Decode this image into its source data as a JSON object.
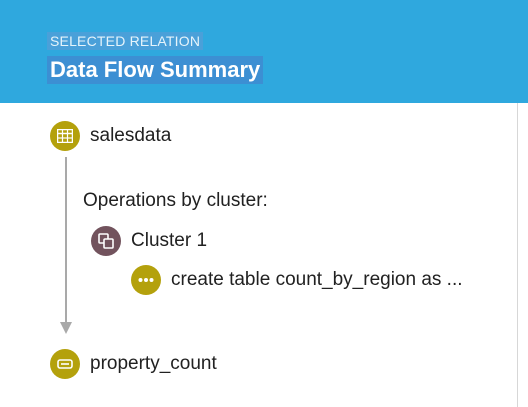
{
  "header": {
    "subtitle": "SELECTED RELATION",
    "title": "Data Flow Summary"
  },
  "flow": {
    "source": {
      "label": "salesdata",
      "icon": "table-icon"
    },
    "operations_label": "Operations by cluster:",
    "cluster": {
      "label": "Cluster 1",
      "icon": "cluster-icon"
    },
    "operation": {
      "label": "create table count_by_region as ...",
      "icon": "more-dots-icon"
    },
    "target": {
      "label": "property_count",
      "icon": "relation-icon"
    }
  },
  "colors": {
    "header_bg": "#2fa8de",
    "node_olive": "#b4a10c",
    "cluster_plum": "#72535d"
  }
}
